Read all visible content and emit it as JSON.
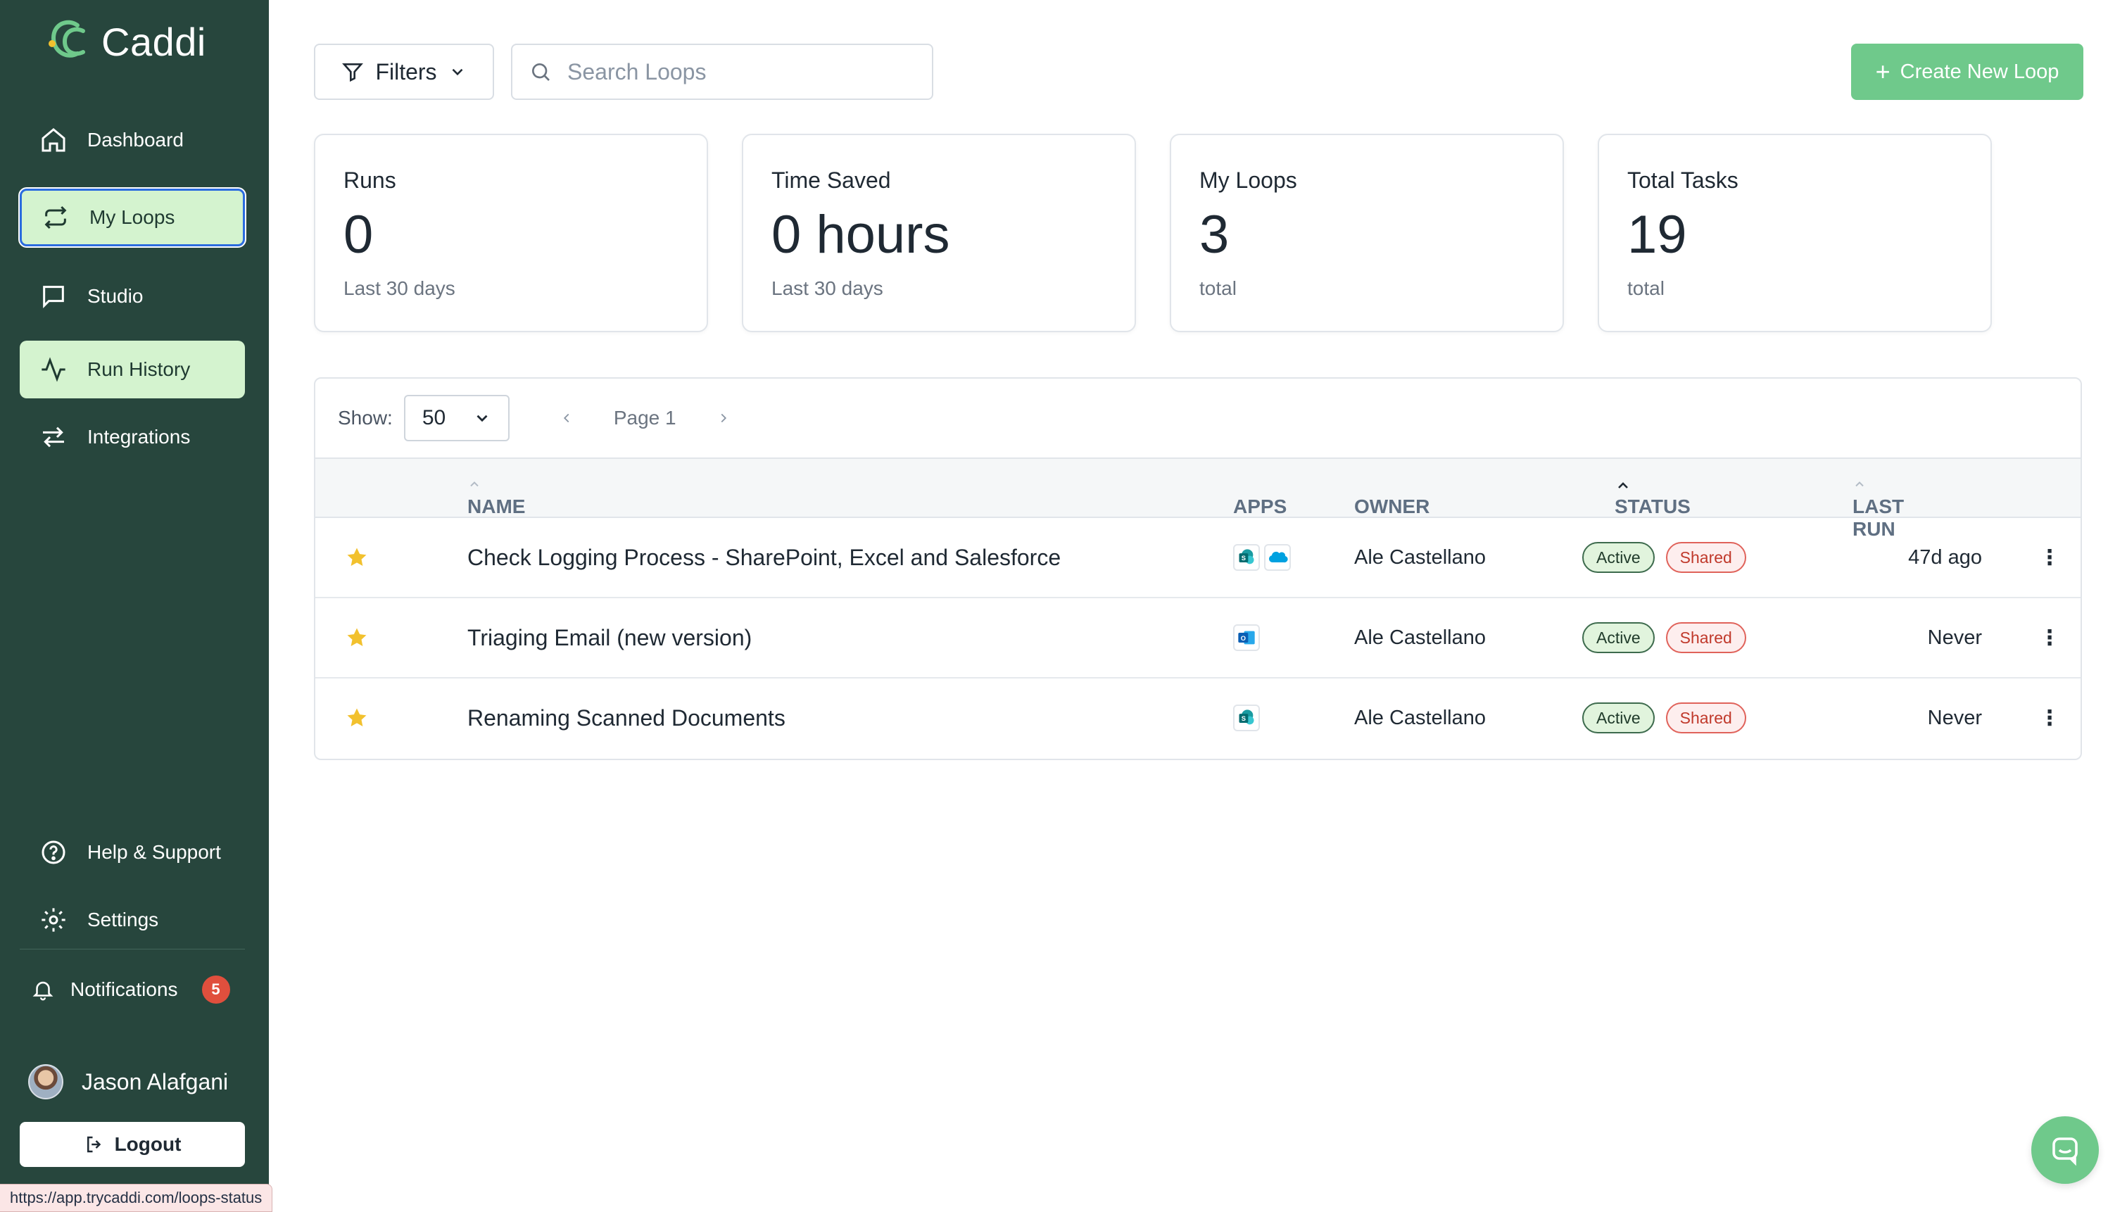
{
  "app": {
    "name": "Caddi"
  },
  "sidebar": {
    "items": [
      {
        "label": "Dashboard",
        "icon": "home-icon"
      },
      {
        "label": "My Loops",
        "icon": "loop-icon"
      },
      {
        "label": "Studio",
        "icon": "chat-icon"
      },
      {
        "label": "Run History",
        "icon": "activity-icon"
      },
      {
        "label": "Integrations",
        "icon": "arrows-icon"
      }
    ],
    "help_label": "Help & Support",
    "settings_label": "Settings",
    "notifications_label": "Notifications",
    "notifications_count": "5",
    "user_name": "Jason Alafgani",
    "logout_label": "Logout"
  },
  "toolbar": {
    "filters_label": "Filters",
    "search_placeholder": "Search Loops",
    "create_label": "Create New Loop"
  },
  "stats": [
    {
      "label": "Runs",
      "value": "0",
      "sub": "Last 30 days"
    },
    {
      "label": "Time Saved",
      "value": "0 hours",
      "sub": "Last 30 days"
    },
    {
      "label": "My Loops",
      "value": "3",
      "sub": "total"
    },
    {
      "label": "Total Tasks",
      "value": "19",
      "sub": "total"
    }
  ],
  "table": {
    "show_label": "Show:",
    "page_size": "50",
    "page_label": "Page 1",
    "columns": {
      "name": "NAME",
      "apps": "APPS",
      "owner": "OWNER",
      "status": "STATUS",
      "last_run": "LAST RUN"
    },
    "rows": [
      {
        "name": "Check Logging Process - SharePoint, Excel and Salesforce",
        "apps": [
          "sharepoint-icon",
          "salesforce-icon"
        ],
        "owner": "Ale Castellano",
        "status": "Active",
        "visibility": "Shared",
        "last_run": "47d ago"
      },
      {
        "name": "Triaging Email (new version)",
        "apps": [
          "outlook-icon"
        ],
        "owner": "Ale Castellano",
        "status": "Active",
        "visibility": "Shared",
        "last_run": "Never"
      },
      {
        "name": "Renaming Scanned Documents",
        "apps": [
          "sharepoint-icon"
        ],
        "owner": "Ale Castellano",
        "status": "Active",
        "visibility": "Shared",
        "last_run": "Never"
      }
    ]
  },
  "status_bar_url": "https://app.trycaddi.com/loops-status",
  "colors": {
    "sidebar": "#27463d",
    "accent": "#6fc98b",
    "nav_active": "#d4f3cf",
    "star": "#f2c12e",
    "badge": "#e04f3d"
  }
}
